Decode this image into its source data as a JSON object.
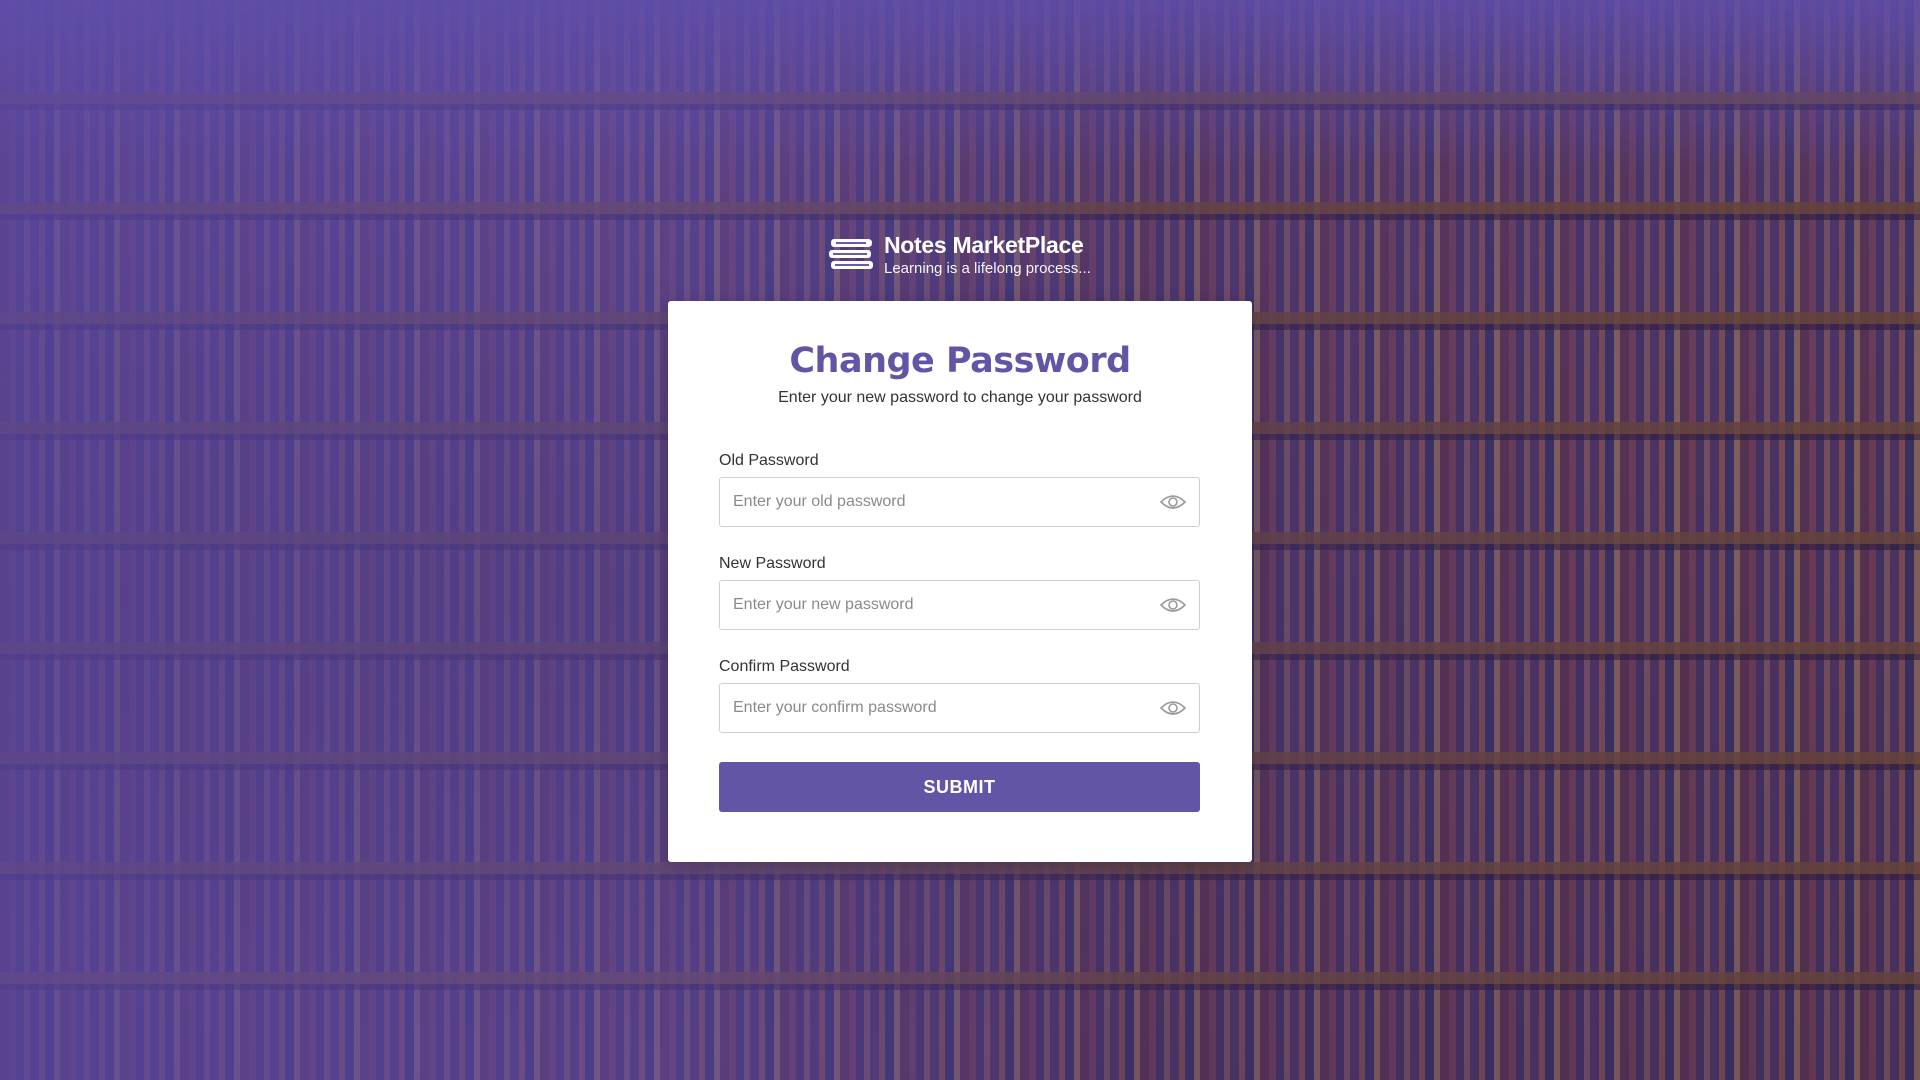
{
  "brand": {
    "name": "Notes MarketPlace",
    "tagline": "Learning is a lifelong process...",
    "logo_icon": "books-stack-icon"
  },
  "form": {
    "title": "Change Password",
    "subtitle": "Enter your new password to change your password",
    "fields": [
      {
        "label": "Old Password",
        "placeholder": "Enter your old password",
        "value": "",
        "icon": "eye-icon"
      },
      {
        "label": "New Password",
        "placeholder": "Enter your new password",
        "value": "",
        "icon": "eye-icon"
      },
      {
        "label": "Confirm Password",
        "placeholder": "Enter your confirm password",
        "value": "",
        "icon": "eye-icon"
      }
    ],
    "submit_label": "SUBMIT"
  },
  "colors": {
    "accent": "#6255a5",
    "card_background": "#ffffff",
    "overlay": "#5846a0"
  }
}
